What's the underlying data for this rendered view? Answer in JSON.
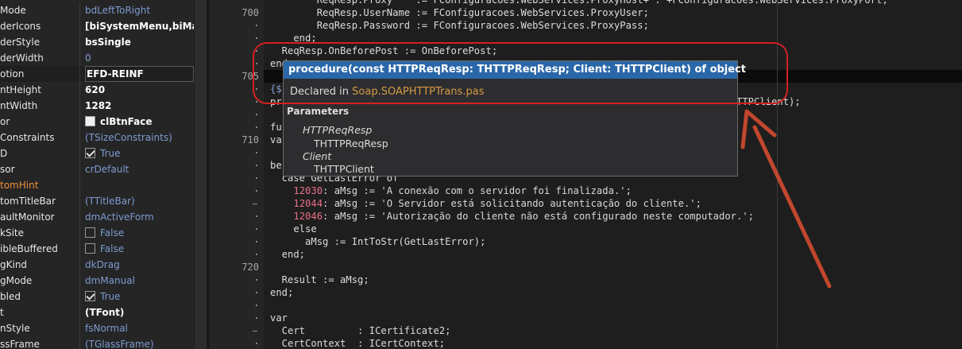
{
  "inspector": {
    "rows": [
      {
        "name": "Mode",
        "value": "bdLeftToRight",
        "kind": "text"
      },
      {
        "name": "derIcons",
        "value": "[biSystemMenu,biMaxim",
        "kind": "bold"
      },
      {
        "name": "derStyle",
        "value": "bsSingle",
        "kind": "bold"
      },
      {
        "name": "derWidth",
        "value": "0",
        "kind": "text"
      },
      {
        "name": "otion",
        "value": "EFD-REINF",
        "kind": "bold"
      },
      {
        "name": "ntHeight",
        "value": "620",
        "kind": "bold"
      },
      {
        "name": "ntWidth",
        "value": "1282",
        "kind": "bold"
      },
      {
        "name": "or",
        "value": "clBtnFace",
        "kind": "color"
      },
      {
        "name": "Constraints",
        "value": "(TSizeConstraints)",
        "kind": "text"
      },
      {
        "name": "D",
        "value": "True",
        "kind": "checked"
      },
      {
        "name": "sor",
        "value": "crDefault",
        "kind": "text"
      },
      {
        "name": "tomHint",
        "value": "",
        "kind": "highlight"
      },
      {
        "name": "tomTitleBar",
        "value": "(TTitleBar)",
        "kind": "text"
      },
      {
        "name": "aultMonitor",
        "value": "dmActiveForm",
        "kind": "text"
      },
      {
        "name": "kSite",
        "value": "False",
        "kind": "unchecked"
      },
      {
        "name": "ibleBuffered",
        "value": "False",
        "kind": "unchecked"
      },
      {
        "name": "gKind",
        "value": "dkDrag",
        "kind": "text"
      },
      {
        "name": "gMode",
        "value": "dmManual",
        "kind": "text"
      },
      {
        "name": "bled",
        "value": "True",
        "kind": "checked"
      },
      {
        "name": "t",
        "value": "(TFont)",
        "kind": "bold"
      },
      {
        "name": "nStyle",
        "value": "fsNormal",
        "kind": "text"
      },
      {
        "name": "ssFrame",
        "value": "(TGlassFrame)",
        "kind": "text"
      }
    ]
  },
  "gutter": {
    "line_numbers": [
      "700",
      "705",
      "710",
      "720"
    ]
  },
  "code": {
    "lines": [
      "        ReqResp.Proxy    := FConfiguracoes.WebServices.ProxyHost+':'+FConfiguracoes.WebServices.ProxyPort;",
      "        ReqResp.UserName := FConfiguracoes.WebServices.ProxyUser;",
      "        ReqResp.Password := FConfiguracoes.WebServices.ProxyPass;",
      "    end;",
      "  ReqResp.OnBeforePost := OnBeforePost;",
      "end;",
      "",
      "{$",
      "pr                                                                    Client: THTTPClient);",
      "",
      "fu",
      "va",
      "",
      "be",
      "  case GetLastError of",
      "    12030: aMsg := 'A conexão com o servidor foi finalizada.';",
      "    12044: aMsg := 'O Servidor está solicitando autenticação do cliente.';",
      "    12046: aMsg := 'Autorização do cliente não está configurado neste computador.';",
      "    else",
      "      aMsg := IntToStr(GetLastError);",
      "  end;",
      "",
      "  Result := aMsg;",
      "end;",
      "",
      "var",
      "  Cert         : ICertificate2;",
      "  CertContext  : ICertContext;"
    ]
  },
  "tooltip": {
    "signature": "procedure(const HTTPReqResp: THTTPReqResp; Client: THTTPClient) of object",
    "declared_prefix": "Declared in ",
    "declared_unit": "Soap.SOAPHTTPTrans.pas",
    "params_label": "Parameters",
    "params": [
      {
        "name": "HTTPReqResp",
        "type": "THTTPReqResp"
      },
      {
        "name": "Client",
        "type": "THTTPClient"
      }
    ]
  },
  "colors": {
    "tooltip_header": "#2a67a8",
    "annotation": "#d32020",
    "arrow": "#c0472e",
    "unit_link": "#d79b43"
  }
}
